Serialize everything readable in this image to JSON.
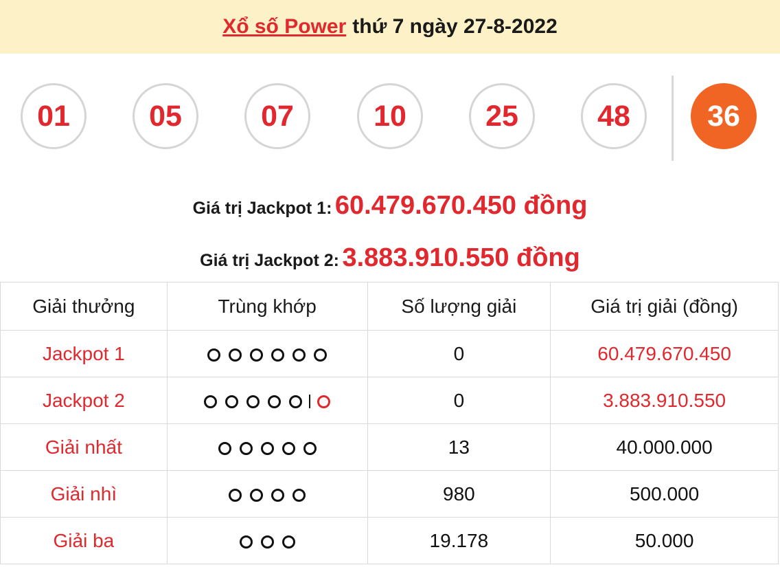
{
  "header": {
    "link_text": "Xổ số Power",
    "date_text": "thứ 7 ngày 27-8-2022"
  },
  "numbers": [
    "01",
    "05",
    "07",
    "10",
    "25",
    "48"
  ],
  "power_number": "36",
  "jackpot1": {
    "label": "Giá trị Jackpot 1:",
    "value": "60.479.670.450 đồng"
  },
  "jackpot2": {
    "label": "Giá trị Jackpot 2:",
    "value": "3.883.910.550 đồng"
  },
  "table": {
    "headers": [
      "Giải thưởng",
      "Trùng khớp",
      "Số lượng giải",
      "Giá trị giải (đồng)"
    ],
    "rows": [
      {
        "prize": "Jackpot 1",
        "matches": 6,
        "power_match": false,
        "count": "0",
        "value": "60.479.670.450",
        "value_red": true
      },
      {
        "prize": "Jackpot 2",
        "matches": 5,
        "power_match": true,
        "count": "0",
        "value": "3.883.910.550",
        "value_red": true
      },
      {
        "prize": "Giải nhất",
        "matches": 5,
        "power_match": false,
        "count": "13",
        "value": "40.000.000",
        "value_red": false
      },
      {
        "prize": "Giải nhì",
        "matches": 4,
        "power_match": false,
        "count": "980",
        "value": "500.000",
        "value_red": false
      },
      {
        "prize": "Giải ba",
        "matches": 3,
        "power_match": false,
        "count": "19.178",
        "value": "50.000",
        "value_red": false
      }
    ]
  },
  "colors": {
    "accent": "#e0282e",
    "power_ball": "#f06424",
    "header_bg": "#fcf1c7"
  }
}
